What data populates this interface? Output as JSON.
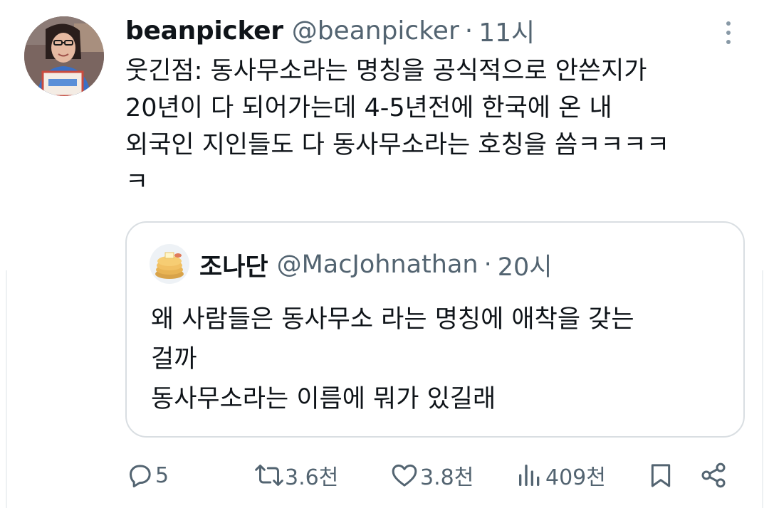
{
  "author": {
    "display_name": "beanpicker",
    "handle": "@beanpicker",
    "separator": "·",
    "time": "11시"
  },
  "tweet": {
    "text": "웃긴점: 동사무소라는 명칭을 공식적으로 안쓴지가\n20년이 다 되어가는데 4-5년전에 한국에 온 내\n외국인 지인들도 다 동사무소라는 호칭을 씀ㅋㅋㅋㅋ\nㅋ"
  },
  "quote": {
    "display_name": "조나단",
    "handle": "@MacJohnathan",
    "separator": "·",
    "time": "20시",
    "text": "왜 사람들은 동사무소 라는 명칭에 애착을 갖는\n걸까\n동사무소라는 이름에 뭐가 있길래"
  },
  "actions": {
    "reply_count": "5",
    "retweet_count": "3.6천",
    "like_count": "3.8천",
    "view_count": "409천"
  },
  "icons": {
    "more": "more-vertical-icon",
    "reply": "reply-icon",
    "retweet": "retweet-icon",
    "like": "heart-icon",
    "views": "views-icon",
    "bookmark": "bookmark-icon",
    "share": "share-icon"
  },
  "colors": {
    "text": "#0f1419",
    "secondary": "#536471",
    "border": "#d9dee2"
  }
}
